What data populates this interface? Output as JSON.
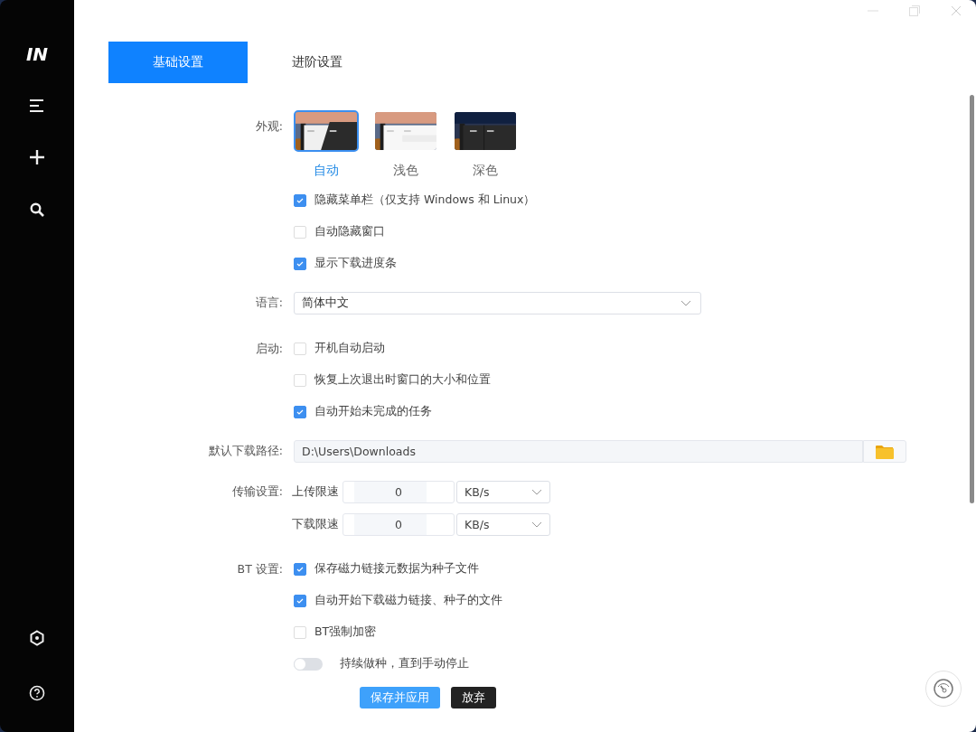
{
  "sidebar": {
    "logo": "IN"
  },
  "tabs": [
    {
      "label": "基础设置",
      "selected": true
    },
    {
      "label": "进阶设置",
      "selected": false
    }
  ],
  "appearance": {
    "label": "外观:",
    "options": [
      {
        "label": "自动",
        "kind": "auto",
        "selected": true
      },
      {
        "label": "浅色",
        "kind": "light",
        "selected": false
      },
      {
        "label": "深色",
        "kind": "dark",
        "selected": false
      }
    ],
    "checks": [
      {
        "label": "隐藏菜单栏（仅支持 Windows 和 Linux）",
        "checked": true
      },
      {
        "label": "自动隐藏窗口",
        "checked": false
      },
      {
        "label": "显示下载进度条",
        "checked": true
      }
    ]
  },
  "language": {
    "label": "语言:",
    "value": "简体中文"
  },
  "startup": {
    "label": "启动:",
    "checks": [
      {
        "label": "开机自动启动",
        "checked": false
      },
      {
        "label": "恢复上次退出时窗口的大小和位置",
        "checked": false
      },
      {
        "label": "自动开始未完成的任务",
        "checked": true
      }
    ]
  },
  "download_path": {
    "label": "默认下载路径:",
    "value": "D:\\Users\\Downloads"
  },
  "transfer": {
    "label": "传输设置:",
    "rows": [
      {
        "label": "上传限速",
        "value": "0",
        "unit": "KB/s"
      },
      {
        "label": "下载限速",
        "value": "0",
        "unit": "KB/s"
      }
    ]
  },
  "bt": {
    "label": "BT 设置:",
    "items": [
      {
        "kind": "checkbox",
        "label": "保存磁力链接元数据为种子文件",
        "checked": true
      },
      {
        "kind": "checkbox",
        "label": "自动开始下载磁力链接、种子的文件",
        "checked": true
      },
      {
        "kind": "checkbox",
        "label": "BT强制加密",
        "checked": false
      },
      {
        "kind": "toggle",
        "label": "持续做种，直到手动停止",
        "checked": false
      }
    ]
  },
  "buttons": [
    {
      "label": "保存并应用",
      "kind": "primary"
    },
    {
      "label": "放弃",
      "kind": "dark"
    }
  ]
}
